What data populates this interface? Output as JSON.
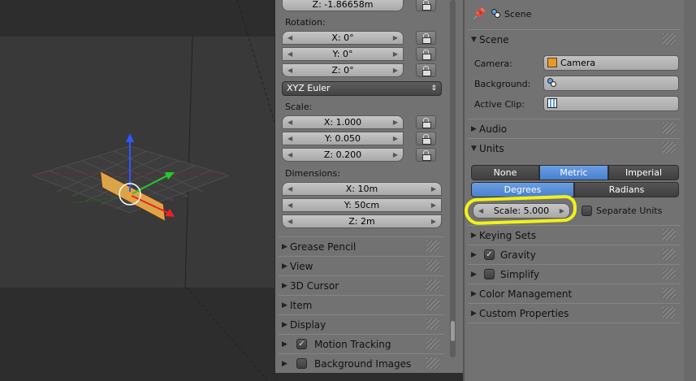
{
  "npanel": {
    "location_z": "Z: -1.86658m",
    "rotation_label": "Rotation:",
    "rotation": [
      "X: 0°",
      "Y: 0°",
      "Z: 0°"
    ],
    "rotation_mode": "XYZ Euler",
    "scale_label": "Scale:",
    "scale": [
      "X: 1.000",
      "Y: 0.050",
      "Z: 0.200"
    ],
    "dimensions_label": "Dimensions:",
    "dimensions": [
      "X: 10m",
      "Y: 50cm",
      "Z: 2m"
    ],
    "panels": [
      "Grease Pencil",
      "View",
      "3D Cursor",
      "Item",
      "Display",
      "Motion Tracking",
      "Background Images"
    ]
  },
  "props": {
    "breadcrumb": "Scene",
    "scene_panel": "Scene",
    "camera_label": "Camera:",
    "camera_value": "Camera",
    "background_label": "Background:",
    "background_value": "",
    "active_clip_label": "Active Clip:",
    "active_clip_value": "",
    "audio_panel": "Audio",
    "units_panel": "Units",
    "unit_system": [
      "None",
      "Metric",
      "Imperial"
    ],
    "unit_system_selected": "Metric",
    "rotation_units": [
      "Degrees",
      "Radians"
    ],
    "rotation_units_selected": "Degrees",
    "scale_field": "Scale: 5.000",
    "separate_units_label": "Separate Units",
    "panels_after": [
      "Keying Sets",
      "Gravity",
      "Simplify",
      "Color Management",
      "Custom Properties"
    ]
  },
  "colors": {
    "highlight": "#f2f216",
    "selected": "#5a8fdc"
  }
}
